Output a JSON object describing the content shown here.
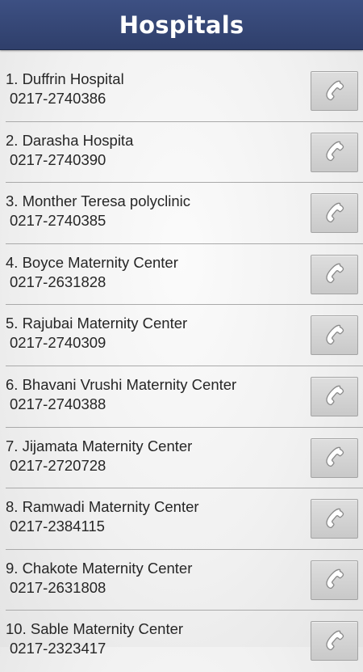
{
  "header": {
    "title": "Hospitals"
  },
  "hospitals": [
    {
      "name": "1. Duffrin Hospital",
      "phone": "0217-2740386",
      "icon": "phone-handset-icon"
    },
    {
      "name": "2. Darasha Hospita",
      "phone": "0217-2740390",
      "icon": "phone-handset-icon"
    },
    {
      "name": "3. Monther Teresa polyclinic",
      "phone": "0217-2740385",
      "icon": "phone-handset-icon"
    },
    {
      "name": "4. Boyce Maternity Center",
      "phone": "0217-2631828",
      "icon": "phone-handset-icon"
    },
    {
      "name": "5. Rajubai Maternity Center",
      "phone": "0217-2740309",
      "icon": "phone-handset-icon"
    },
    {
      "name": "6. Bhavani Vrushi Maternity Center",
      "phone": "0217-2740388",
      "icon": "phone-handset-icon"
    },
    {
      "name": "7. Jijamata Maternity Center",
      "phone": "0217-2720728",
      "icon": "phone-handset-icon"
    },
    {
      "name": "8. Ramwadi Maternity Center",
      "phone": "0217-2384115",
      "icon": "phone-handset-icon"
    },
    {
      "name": "9. Chakote Maternity Center",
      "phone": "0217-2631808",
      "icon": "phone-handset-icon"
    },
    {
      "name": "10. Sable Maternity Center",
      "phone": "0217-2323417",
      "icon": "phone-handset-icon"
    }
  ],
  "colors": {
    "header_background": "#33446f",
    "header_text": "#ffffff",
    "list_text": "#262626",
    "divider": "#a9a9a9",
    "button_background": "#d3d3d3"
  }
}
